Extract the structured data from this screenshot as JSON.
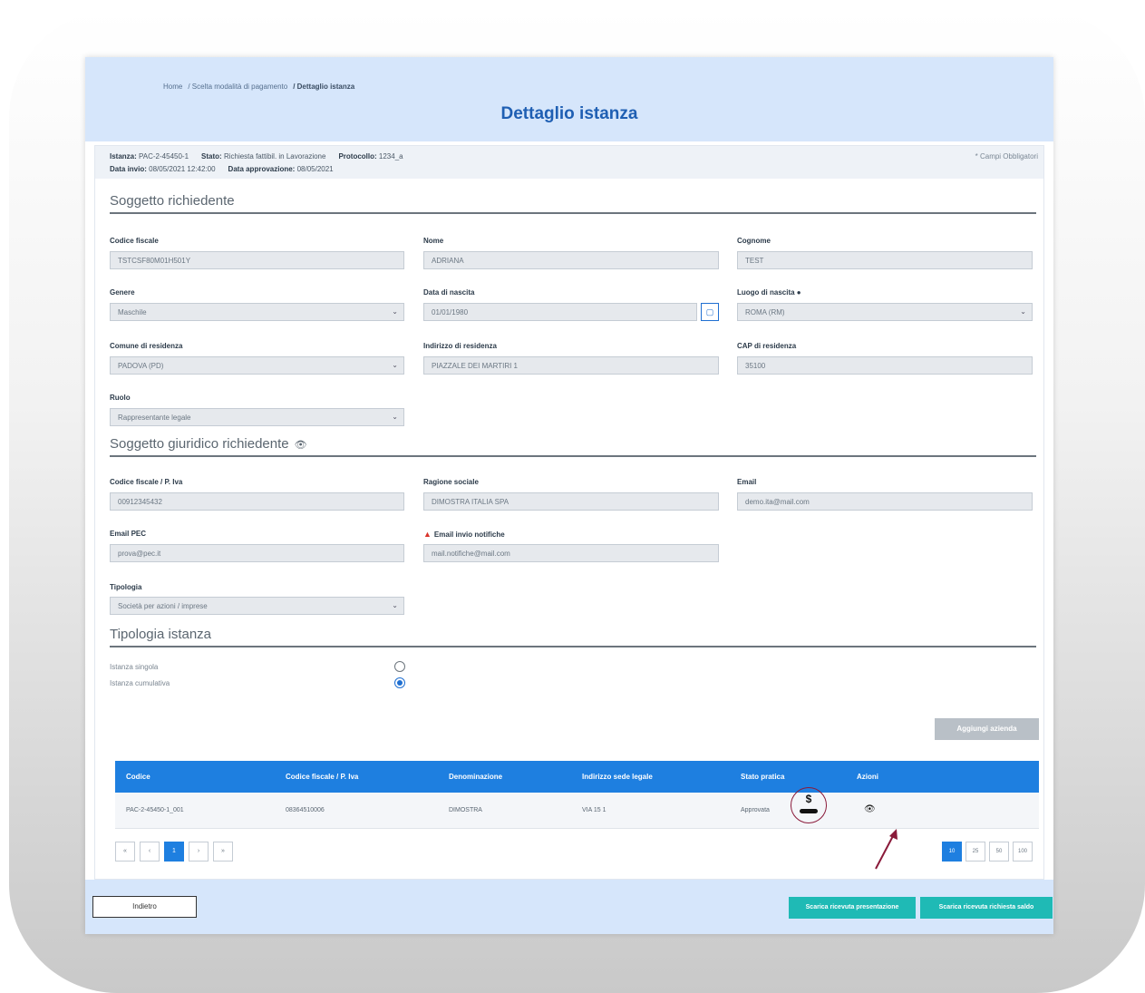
{
  "breadcrumb": [
    "Home",
    "/ Scelta modalità di pagamento",
    "/ Dettaglio istanza"
  ],
  "page_title": "Dettaglio istanza",
  "info": {
    "istanza_label": "Istanza:",
    "istanza_value": "PAC-2-45450-1",
    "stato_label": "Stato:",
    "stato_value": "Richiesta fattibil. in Lavorazione",
    "protocollo_label": "Protocollo:",
    "protocollo_value": "1234_a",
    "data_invio_label": "Data invio:",
    "data_invio_value": "08/05/2021 12:42:00",
    "data_approvazione_label": "Data approvazione:",
    "data_approvazione_value": "08/05/2021",
    "required_note": "* Campi Obbligatori"
  },
  "sections": {
    "soggetto": "Soggetto richiedente",
    "soggetto_giuridico": "Soggetto giuridico richiedente",
    "tipologia_istanza": "Tipologia istanza"
  },
  "soggetto": {
    "codice_fiscale_label": "Codice fiscale",
    "codice_fiscale_value": "TSTCSF80M01H501Y",
    "nome_label": "Nome",
    "nome_value": "ADRIANA",
    "cognome_label": "Cognome",
    "cognome_value": "TEST",
    "genere_label": "Genere",
    "genere_value": "Maschile",
    "data_nascita_label": "Data di nascita",
    "data_nascita_value": "01/01/1980",
    "luogo_nascita_label": "Luogo di nascita",
    "luogo_nascita_value": "ROMA (RM)",
    "comune_label": "Comune di residenza",
    "comune_value": "PADOVA (PD)",
    "indirizzo_label": "Indirizzo di residenza",
    "indirizzo_value": "PIAZZALE DEI MARTIRI 1",
    "cap_label": "CAP di residenza",
    "cap_value": "35100",
    "ruolo_label": "Ruolo",
    "ruolo_value": "Rappresentante legale"
  },
  "giuridico": {
    "cf_label": "Codice fiscale / P. Iva",
    "cf_value": "00912345432",
    "ragione_label": "Ragione sociale",
    "ragione_value": "DIMOSTRA ITALIA SPA",
    "email_label": "Email",
    "email_value": "demo.ita@mail.com",
    "pec_label": "Email PEC",
    "pec_value": "prova@pec.it",
    "notifiche_label": "Email invio notifiche",
    "notifiche_value": "mail.notifiche@mail.com",
    "tipologia_label": "Tipologia",
    "tipologia_value": "Società per azioni / imprese"
  },
  "tipologia": {
    "singola_label": "Istanza singola",
    "cumulativa_label": "Istanza cumulativa"
  },
  "add_button": "Aggiungi azienda",
  "table": {
    "headers": [
      "Codice",
      "Codice fiscale / P. Iva",
      "Denominazione",
      "Indirizzo sede legale",
      "Stato pratica",
      "Azioni"
    ],
    "row": [
      "PAC-2-45450-1_001",
      "08364510006",
      "DIMOSTRA",
      "VIA 15 1",
      "Approvata"
    ]
  },
  "pagination": [
    "«",
    "‹",
    "1",
    "›",
    "»"
  ],
  "page_sizes": [
    "10",
    "25",
    "50",
    "100"
  ],
  "footer": {
    "back": "Indietro",
    "download1": "Scarica ricevuta presentazione",
    "download2": "Scarica ricevuta richiesta saldo"
  },
  "colors": {
    "accent": "#1e7fe0",
    "header_bg": "#d6e6fb",
    "teal": "#1fbab5",
    "highlight": "#8a1a3a"
  },
  "icons": {
    "calendar": "calendar-icon",
    "eye": "eye-icon",
    "payment": "dollar-hand-icon",
    "warning": "warning-icon"
  }
}
